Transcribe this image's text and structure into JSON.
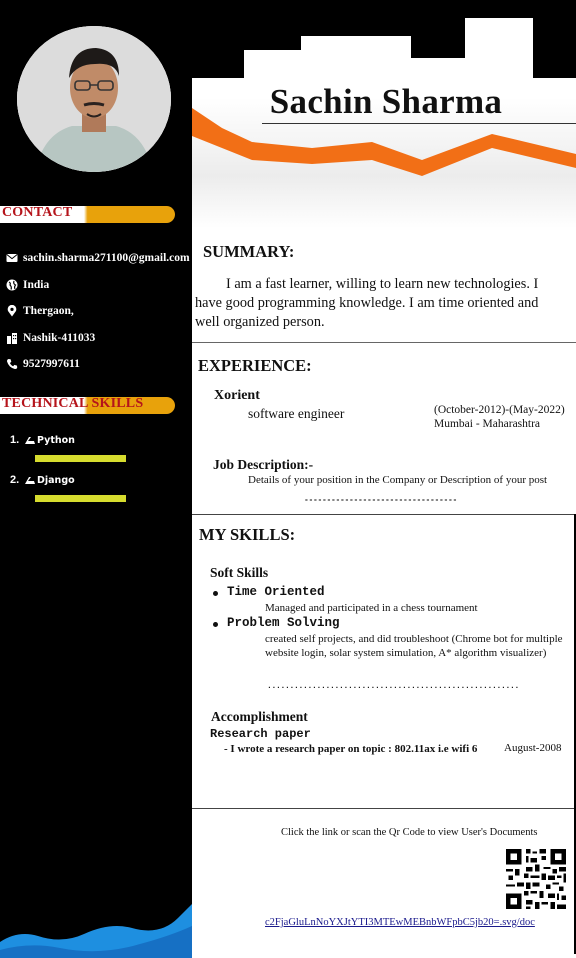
{
  "person": {
    "name": "Sachin Sharma"
  },
  "sidebar": {
    "contact_heading": "CONTACT",
    "contact": [
      {
        "icon": "envelope-icon",
        "text": "sachin.sharma271100@gmail.com"
      },
      {
        "icon": "globe-icon",
        "text": "India"
      },
      {
        "icon": "location-pin-icon",
        "text": "Thergaon,"
      },
      {
        "icon": "building-icon",
        "text": "Nashik-411033"
      },
      {
        "icon": "phone-icon",
        "text": "9527997611"
      }
    ],
    "skills_heading": "TECHNICAL SKILLS",
    "skills": [
      {
        "num": "1.",
        "name": "Python",
        "icon": "skill-logo-icon",
        "level": 1.0
      },
      {
        "num": "2.",
        "name": "Django",
        "icon": "skill-logo-icon",
        "level": 1.0
      }
    ]
  },
  "summary": {
    "heading": "SUMMARY:",
    "text": "I am a fast learner, willing to learn new technologies. I have good programming knowledge. I am time oriented and well organized person."
  },
  "experience": {
    "heading": "EXPERIENCE:",
    "company": "Xorient",
    "role": "software engineer",
    "dates": "(October-2012)-(May-2022)",
    "location": "Mumbai - Maharashtra",
    "jd_heading": "Job Description:-",
    "jd_text": "Details of your position in the Company or Description of your post",
    "separator": "----------------------------------"
  },
  "skills": {
    "heading": "MY SKILLS:",
    "soft_heading": "Soft Skills",
    "items": [
      {
        "title": "Time Oriented",
        "desc": "Managed and participated in a chess tournament"
      },
      {
        "title": "Problem Solving",
        "desc": "created self projects, and did troubleshoot (Chrome bot for multiple website login, solar system simulation, A* algorithm visualizer)"
      }
    ],
    "separator": "........................................................"
  },
  "accomplishment": {
    "heading": "Accomplishment",
    "sub": "Research paper",
    "text": "- I wrote a research paper on topic : 802.11ax i.e wifi 6",
    "date": "August-2008"
  },
  "footer": {
    "caption": "Click the link or scan the Qr Code to view User's Documents",
    "link": "c2FjaGluLnNoYXJtYTI3MTEwMEBnbWFpbC5jb20=.svg/doc"
  },
  "colors": {
    "accent_orange": "#f26f16",
    "pill_gold": "#e8a20b",
    "heading_red": "#b5141b",
    "skill_bar": "#d6dc2e",
    "wave_blue": "#1e8fe0"
  }
}
